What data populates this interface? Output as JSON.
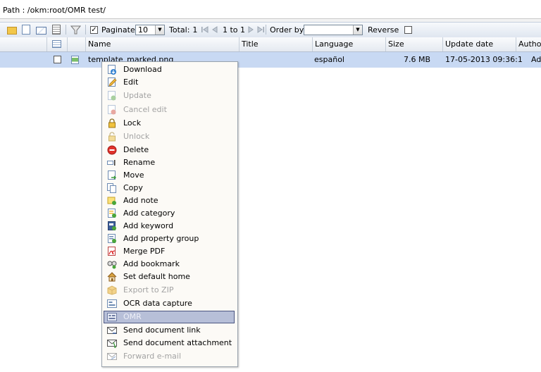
{
  "path": {
    "text": "Path : /okm:root/OMR test/"
  },
  "toolbar": {
    "paginate_label": "Paginate",
    "paginate_checked": true,
    "page_size": "10",
    "total_label": "Total:",
    "total_value": "1",
    "range": "1 to 1",
    "order_by_label": "Order by",
    "order_by_value": "",
    "reverse_label": "Reverse",
    "reverse_checked": false
  },
  "table": {
    "columns": [
      "Name",
      "Title",
      "Language",
      "Size",
      "Update date",
      "Author"
    ],
    "rows": [
      {
        "name": "template_marked.png",
        "title": "",
        "language": "español",
        "size": "7.6 MB",
        "update_date": "17-05-2013 09:36:1",
        "author": "Adm"
      }
    ]
  },
  "context_menu": {
    "items": [
      {
        "label": "Download",
        "icon": "download-icon",
        "enabled": true
      },
      {
        "label": "Edit",
        "icon": "edit-icon",
        "enabled": true
      },
      {
        "label": "Update",
        "icon": "update-icon",
        "enabled": false
      },
      {
        "label": "Cancel edit",
        "icon": "cancel-edit-icon",
        "enabled": false
      },
      {
        "label": "Lock",
        "icon": "lock-icon",
        "enabled": true
      },
      {
        "label": "Unlock",
        "icon": "unlock-icon",
        "enabled": false
      },
      {
        "label": "Delete",
        "icon": "delete-icon",
        "enabled": true
      },
      {
        "label": "Rename",
        "icon": "rename-icon",
        "enabled": true
      },
      {
        "label": "Move",
        "icon": "move-icon",
        "enabled": true
      },
      {
        "label": "Copy",
        "icon": "copy-icon",
        "enabled": true
      },
      {
        "label": "Add note",
        "icon": "note-icon",
        "enabled": true
      },
      {
        "label": "Add category",
        "icon": "category-icon",
        "enabled": true
      },
      {
        "label": "Add keyword",
        "icon": "keyword-icon",
        "enabled": true
      },
      {
        "label": "Add property group",
        "icon": "property-group-icon",
        "enabled": true
      },
      {
        "label": "Merge PDF",
        "icon": "pdf-icon",
        "enabled": true
      },
      {
        "label": "Add bookmark",
        "icon": "bookmark-icon",
        "enabled": true
      },
      {
        "label": "Set default home",
        "icon": "home-icon",
        "enabled": true
      },
      {
        "label": "Export to ZIP",
        "icon": "zip-icon",
        "enabled": false
      },
      {
        "label": "OCR data capture",
        "icon": "ocr-icon",
        "enabled": true
      },
      {
        "label": "OMR",
        "icon": "omr-icon",
        "enabled": true,
        "highlighted": true
      },
      {
        "label": "Send document link",
        "icon": "send-link-icon",
        "enabled": true
      },
      {
        "label": "Send document attachment",
        "icon": "send-attachment-icon",
        "enabled": true
      },
      {
        "label": "Forward e-mail",
        "icon": "forward-email-icon",
        "enabled": false
      }
    ]
  },
  "colors": {
    "selected_row": "#c8d9f3",
    "menu_background": "#fcfaf6",
    "menu_highlight": "#b7bfd8",
    "disabled_text": "#a3a3a3"
  }
}
